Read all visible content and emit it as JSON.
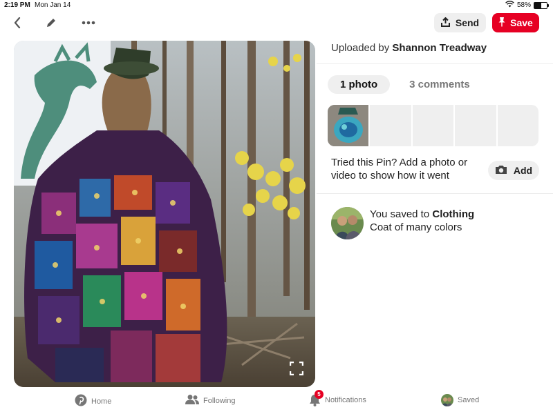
{
  "status_bar": {
    "time": "2:19 PM",
    "date": "Mon Jan 14",
    "battery_percent": 58,
    "battery_label": "58%",
    "icons": [
      "wifi-icon",
      "battery-icon"
    ]
  },
  "toolbar": {
    "back_icon": "chevron-left-icon",
    "edit_icon": "pencil-icon",
    "more_icon": "more-dots-icon",
    "send_label": "Send",
    "send_icon": "share-up-icon",
    "save_label": "Save",
    "save_icon": "pin-icon"
  },
  "pin": {
    "expand_icon": "expand-icon"
  },
  "details": {
    "uploaded_by_prefix": "Uploaded by",
    "uploader_name": "Shannon Treadway",
    "tabs": [
      {
        "label": "1 photo",
        "active": true
      },
      {
        "label": "3 comments",
        "active": false
      }
    ],
    "tried_text": "Tried this Pin? Add a photo or video to show how it went",
    "add_label": "Add",
    "add_icon": "camera-icon",
    "saved_prefix": "You saved to",
    "saved_board": "Clothing",
    "pin_title": "Coat of many colors"
  },
  "nav": {
    "items": [
      {
        "label": "Home",
        "icon": "pinterest-logo-icon"
      },
      {
        "label": "Following",
        "icon": "people-icon"
      },
      {
        "label": "Notifications",
        "icon": "bell-icon",
        "badge": "5"
      },
      {
        "label": "Saved",
        "icon": "avatar-icon"
      }
    ]
  },
  "colors": {
    "brand_red": "#e60023",
    "button_gray": "#efefef",
    "text_muted": "#767676"
  }
}
